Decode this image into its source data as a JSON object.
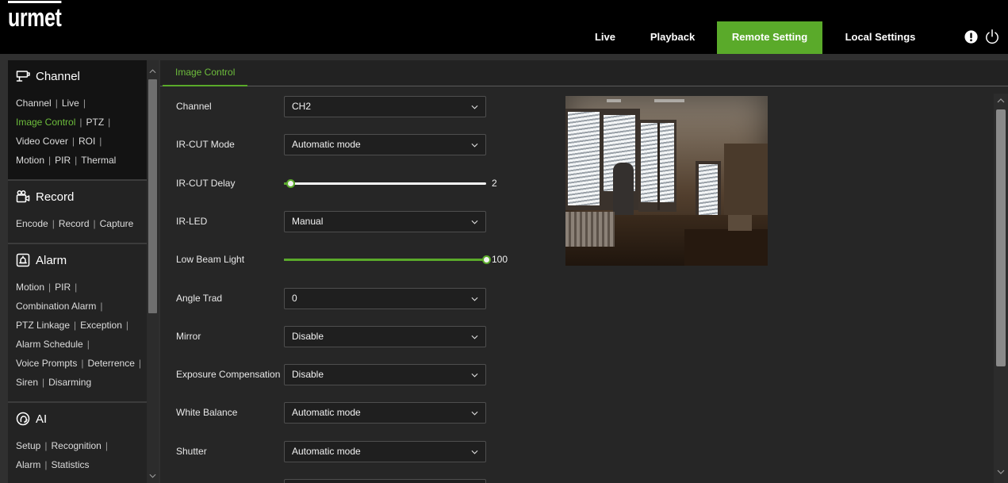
{
  "colors": {
    "accent": "#5aaa2a",
    "accent_text": "#6dbd3c",
    "topbar": "#000000",
    "panel": "#262626"
  },
  "header": {
    "logo": "urmet",
    "nav": [
      {
        "label": "Live",
        "active": false
      },
      {
        "label": "Playback",
        "active": false
      },
      {
        "label": "Remote Setting",
        "active": true
      },
      {
        "label": "Local Settings",
        "active": false
      }
    ],
    "icons": [
      "alert-icon",
      "power-icon"
    ]
  },
  "sidebar": {
    "separator": "|",
    "sections": [
      {
        "title": "Channel",
        "icon": "channel-icon",
        "active": true,
        "rows": [
          [
            {
              "label": "Channel"
            },
            {
              "label": "Live"
            }
          ],
          [
            {
              "label": "Image Control",
              "active": true
            },
            {
              "label": "PTZ"
            }
          ],
          [
            {
              "label": "Video Cover"
            },
            {
              "label": "ROI"
            }
          ],
          [
            {
              "label": "Motion"
            },
            {
              "label": "PIR"
            },
            {
              "label": "Thermal"
            }
          ]
        ]
      },
      {
        "title": "Record",
        "icon": "record-icon",
        "active": false,
        "rows": [
          [
            {
              "label": "Encode"
            },
            {
              "label": "Record"
            },
            {
              "label": "Capture"
            }
          ]
        ]
      },
      {
        "title": "Alarm",
        "icon": "alarm-icon",
        "active": false,
        "rows": [
          [
            {
              "label": "Motion"
            },
            {
              "label": "PIR"
            }
          ],
          [
            {
              "label": "Combination Alarm"
            }
          ],
          [
            {
              "label": "PTZ Linkage"
            },
            {
              "label": "Exception"
            }
          ],
          [
            {
              "label": "Alarm Schedule"
            }
          ],
          [
            {
              "label": "Voice Prompts"
            },
            {
              "label": "Deterrence"
            }
          ],
          [
            {
              "label": "Siren"
            },
            {
              "label": "Disarming"
            }
          ]
        ]
      },
      {
        "title": "AI",
        "icon": "ai-icon",
        "active": false,
        "rows": [
          [
            {
              "label": "Setup"
            },
            {
              "label": "Recognition"
            }
          ],
          [
            {
              "label": "Alarm"
            },
            {
              "label": "Statistics"
            }
          ]
        ]
      }
    ]
  },
  "main": {
    "tabs": [
      {
        "label": "Image Control",
        "active": true
      }
    ],
    "form": [
      {
        "label": "Channel",
        "type": "select",
        "value": "CH2"
      },
      {
        "label": "IR-CUT Mode",
        "type": "select",
        "value": "Automatic mode"
      },
      {
        "label": "IR-CUT Delay",
        "type": "slider",
        "value": "2",
        "level_percent": 3
      },
      {
        "label": "IR-LED",
        "type": "select",
        "value": "Manual"
      },
      {
        "label": "Low Beam Light",
        "type": "slider",
        "value": "100",
        "level_percent": 100
      },
      {
        "label": "Angle Trad",
        "type": "select",
        "value": "0"
      },
      {
        "label": "Mirror",
        "type": "select",
        "value": "Disable"
      },
      {
        "label": "Exposure Compensation",
        "type": "select",
        "value": "Disable"
      },
      {
        "label": "White Balance",
        "type": "select",
        "value": "Automatic mode"
      },
      {
        "label": "Shutter",
        "type": "select",
        "value": "Automatic mode"
      },
      {
        "label": "",
        "type": "select",
        "value": ""
      }
    ]
  }
}
